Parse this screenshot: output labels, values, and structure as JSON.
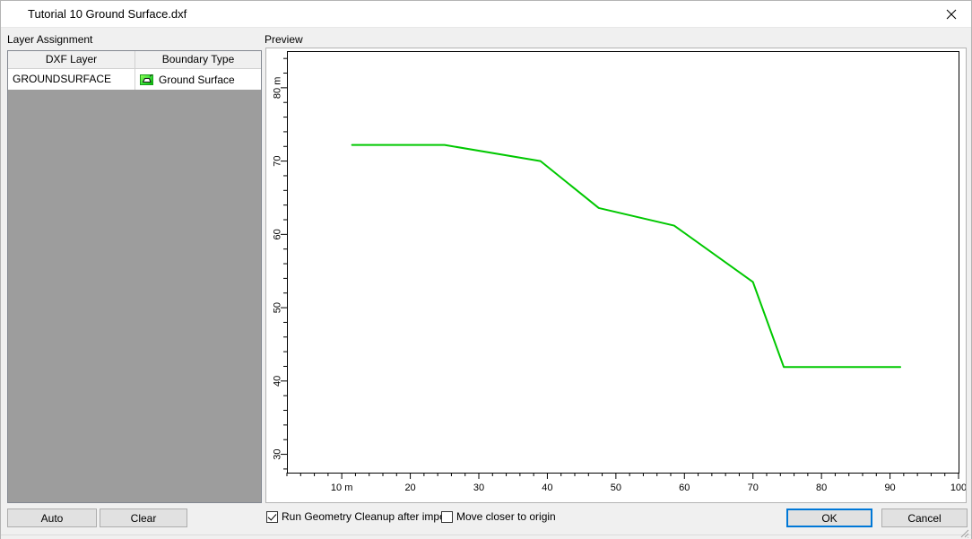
{
  "window": {
    "title": "Tutorial 10 Ground Surface.dxf",
    "close_icon": "close-icon"
  },
  "groups": {
    "layer_assignment_label": "Layer Assignment",
    "preview_label": "Preview"
  },
  "table": {
    "columns": [
      "DXF Layer",
      "Boundary Type"
    ],
    "rows": [
      {
        "dxf_layer": "GROUNDSURFACE",
        "boundary_type": "Ground Surface",
        "boundary_type_icon": "ground-surface-icon"
      }
    ]
  },
  "buttons": {
    "auto": "Auto",
    "clear": "Clear",
    "ok": "OK",
    "cancel": "Cancel"
  },
  "options": {
    "run_cleanup": {
      "label": "Run Geometry Cleanup after import",
      "checked": true
    },
    "move_closer": {
      "label": "Move closer to origin",
      "checked": false
    }
  },
  "colors": {
    "accent": "#0078d7",
    "ground_surface_line": "#00c800",
    "icon_green_light": "#7cf03c",
    "icon_green_dark": "#00a000",
    "panel_gray": "#9d9d9d",
    "dialog_bg": "#f0f0f0"
  },
  "chart_data": {
    "type": "line",
    "title": "",
    "xlabel": "",
    "ylabel": "",
    "xlim": [
      2,
      100
    ],
    "ylim": [
      27.5,
      85
    ],
    "grid": false,
    "legend": null,
    "x_tick_labels": [
      "10 m",
      "20",
      "30",
      "40",
      "50",
      "60",
      "70",
      "80",
      "90",
      "100"
    ],
    "x_ticks": [
      10,
      20,
      30,
      40,
      50,
      60,
      70,
      80,
      90,
      100
    ],
    "y_tick_labels": [
      "80 m",
      "70",
      "60",
      "50",
      "40",
      "30"
    ],
    "y_ticks": [
      80,
      70,
      60,
      50,
      40,
      30
    ],
    "x_minor_step": 2,
    "y_minor_step": 2,
    "series": [
      {
        "name": "Ground Surface",
        "color": "#00c800",
        "x": [
          11.5,
          25.0,
          39.0,
          47.5,
          58.5,
          70.0,
          74.5,
          91.5
        ],
        "y": [
          72.2,
          72.2,
          70.0,
          63.6,
          61.2,
          53.5,
          41.9,
          41.9
        ]
      }
    ]
  }
}
